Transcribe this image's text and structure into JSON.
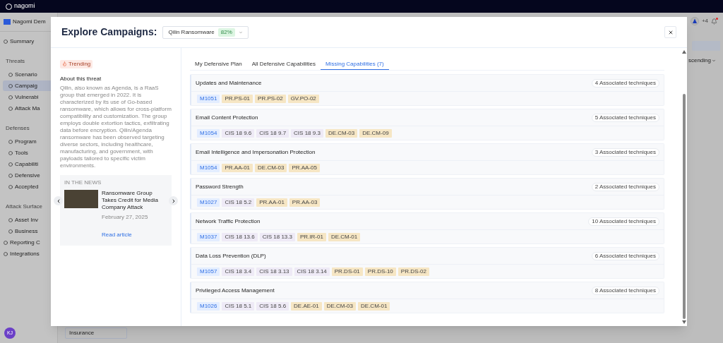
{
  "app": {
    "logo": "nagomi",
    "org": "Nagomi Dem",
    "user_initials": "KJ",
    "extra_count": "+4",
    "sort_label": "scending",
    "card_label": "Insurance",
    "sidebar": [
      {
        "kind": "item",
        "label": "Summary",
        "selected": false
      },
      {
        "kind": "section",
        "label": "Threats"
      },
      {
        "kind": "subitem",
        "label": "Scenario",
        "selected": false
      },
      {
        "kind": "subitem",
        "label": "Campaig",
        "selected": true
      },
      {
        "kind": "subitem",
        "label": "Vulnerabi",
        "selected": false
      },
      {
        "kind": "subitem",
        "label": "Attack Ma",
        "selected": false
      },
      {
        "kind": "section",
        "label": "Defenses"
      },
      {
        "kind": "subitem",
        "label": "Program",
        "selected": false
      },
      {
        "kind": "subitem",
        "label": "Tools",
        "selected": false
      },
      {
        "kind": "subitem",
        "label": "Capabiliti",
        "selected": false
      },
      {
        "kind": "subitem",
        "label": "Defensive",
        "selected": false
      },
      {
        "kind": "subitem",
        "label": "Accepted",
        "selected": false
      },
      {
        "kind": "section",
        "label": "Attack Surface"
      },
      {
        "kind": "subitem",
        "label": "Asset Inv",
        "selected": false
      },
      {
        "kind": "subitem",
        "label": "Business",
        "selected": false
      },
      {
        "kind": "item",
        "label": "Reporting C",
        "selected": false
      },
      {
        "kind": "item",
        "label": "Integrations",
        "selected": false
      }
    ]
  },
  "modal": {
    "title": "Explore Campaigns:",
    "campaign": {
      "value": "Qilin Ransomware",
      "score": "82%"
    },
    "trending": "Trending",
    "about_heading": "About this threat",
    "about_text": "Qilin, also known as Agenda, is a RaaS group that emerged in 2022. It is characterized by its use of Go-based ransomware, which allows for cross-platform compatibility and customization. The group employs double extortion tactics, exfiltrating data before encryption. Qilin/Agenda ransomware has been observed targeting diverse sectors, including healthcare, manufacturing, and government, with payloads tailored to specific victim environments.",
    "news": {
      "heading": "IN THE NEWS",
      "headline": "Ransomware Group Takes Credit for Media Company Attack",
      "date": "February 27, 2025",
      "link": "Read article"
    },
    "tabs": [
      {
        "label": "My Defensive Plan",
        "selected": false
      },
      {
        "label": "All Defensive Capabilities",
        "selected": false
      },
      {
        "label": "Missing Capabilities (7)",
        "selected": true
      }
    ],
    "capabilities": [
      {
        "name": "Updates and Maintenance",
        "count": "4 Associated techniques",
        "tags": [
          {
            "kind": "mitre",
            "text": "M1051"
          },
          {
            "kind": "nist",
            "text": "PR.PS-01"
          },
          {
            "kind": "nist",
            "text": "PR.PS-02"
          },
          {
            "kind": "nist",
            "text": "GV.PO-02"
          }
        ]
      },
      {
        "name": "Email Content Protection",
        "count": "5 Associated techniques",
        "tags": [
          {
            "kind": "mitre",
            "text": "M1054"
          },
          {
            "kind": "cis",
            "text": "CIS 18 9.6"
          },
          {
            "kind": "cis",
            "text": "CIS 18 9.7"
          },
          {
            "kind": "cis",
            "text": "CIS 18 9.3"
          },
          {
            "kind": "nist",
            "text": "DE.CM-03"
          },
          {
            "kind": "nist",
            "text": "DE.CM-09"
          }
        ]
      },
      {
        "name": "Email Intelligence and Impersonation Protection",
        "count": "3 Associated techniques",
        "tags": [
          {
            "kind": "mitre",
            "text": "M1054"
          },
          {
            "kind": "nist",
            "text": "PR.AA-01"
          },
          {
            "kind": "nist",
            "text": "DE.CM-03"
          },
          {
            "kind": "nist",
            "text": "PR.AA-05"
          }
        ]
      },
      {
        "name": "Password Strength",
        "count": "2 Associated techniques",
        "tags": [
          {
            "kind": "mitre",
            "text": "M1027"
          },
          {
            "kind": "cis",
            "text": "CIS 18 5.2"
          },
          {
            "kind": "nist",
            "text": "PR.AA-01"
          },
          {
            "kind": "nist",
            "text": "PR.AA-03"
          }
        ]
      },
      {
        "name": "Network Traffic Protection",
        "count": "10 Associated techniques",
        "tags": [
          {
            "kind": "mitre",
            "text": "M1037"
          },
          {
            "kind": "cis",
            "text": "CIS 18 13.6"
          },
          {
            "kind": "cis",
            "text": "CIS 18 13.3"
          },
          {
            "kind": "nist",
            "text": "PR.IR-01"
          },
          {
            "kind": "nist",
            "text": "DE.CM-01"
          }
        ]
      },
      {
        "name": "Data Loss Prevention (DLP)",
        "count": "6 Associated techniques",
        "tags": [
          {
            "kind": "mitre",
            "text": "M1057"
          },
          {
            "kind": "cis",
            "text": "CIS 18 3.4"
          },
          {
            "kind": "cis",
            "text": "CIS 18 3.13"
          },
          {
            "kind": "cis",
            "text": "CIS 18 3.14"
          },
          {
            "kind": "nist",
            "text": "PR.DS-01"
          },
          {
            "kind": "nist",
            "text": "PR.DS-10"
          },
          {
            "kind": "nist",
            "text": "PR.DS-02"
          }
        ]
      },
      {
        "name": "Privileged Access Management",
        "count": "8 Associated techniques",
        "tags": [
          {
            "kind": "mitre",
            "text": "M1026"
          },
          {
            "kind": "cis",
            "text": "CIS 18 5.1"
          },
          {
            "kind": "cis",
            "text": "CIS 18 5.6"
          },
          {
            "kind": "nist",
            "text": "DE.AE-01"
          },
          {
            "kind": "nist",
            "text": "DE.CM-03"
          },
          {
            "kind": "nist",
            "text": "DE.CM-01"
          }
        ]
      }
    ]
  }
}
